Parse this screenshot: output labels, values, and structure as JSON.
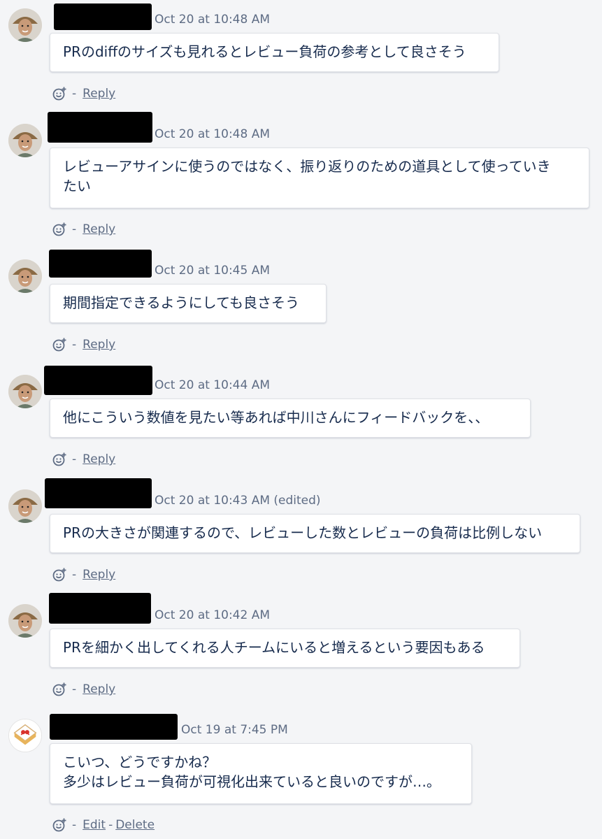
{
  "comments": [
    {
      "timestamp": "Oct 20 at 10:48 AM",
      "lines": [
        "PRのdiffのサイズも見れるとレビュー負荷の参考として良さそう"
      ],
      "actions": {
        "reply": "Reply"
      },
      "avatar_icon": "user-avatar-photo-icon"
    },
    {
      "timestamp": "Oct 20 at 10:48 AM",
      "lines": [
        "レビューアサインに使うのではなく、振り返りのための道具として使っていき",
        "たい"
      ],
      "actions": {
        "reply": "Reply"
      },
      "avatar_icon": "user-avatar-photo-icon"
    },
    {
      "timestamp": "Oct 20 at 10:45 AM",
      "lines": [
        "期間指定できるようにしても良さそう"
      ],
      "actions": {
        "reply": "Reply"
      },
      "avatar_icon": "user-avatar-photo-icon"
    },
    {
      "timestamp": "Oct 20 at 10:44 AM",
      "lines": [
        "他にこういう数値を見たい等あれば中川さんにフィードバックを、、"
      ],
      "actions": {
        "reply": "Reply"
      },
      "avatar_icon": "user-avatar-photo-icon"
    },
    {
      "timestamp": "Oct 20 at 10:43 AM (edited)",
      "lines": [
        "PRの大きさが関連するので、レビューした数とレビューの負荷は比例しない"
      ],
      "actions": {
        "reply": "Reply"
      },
      "avatar_icon": "user-avatar-photo-icon"
    },
    {
      "timestamp": "Oct 20 at 10:42 AM",
      "lines": [
        "PRを細かく出してくれる人チームにいると増えるという要因もある"
      ],
      "actions": {
        "reply": "Reply"
      },
      "avatar_icon": "user-avatar-photo-icon"
    },
    {
      "timestamp": "Oct 19 at 7:45 PM",
      "lines": [
        "こいつ、どうですかね？",
        "多少はレビュー負荷が可視化出来ていると良いのですが…。"
      ],
      "actions": {
        "edit": "Edit",
        "delete": "Delete"
      },
      "avatar_icon": "app-logo-avatar-icon"
    }
  ],
  "colors": {
    "background": "#f4f5f7",
    "bubble": "#ffffff",
    "muted_text": "#5e6c84",
    "body_text": "#172b4d",
    "redaction": "#000000"
  }
}
